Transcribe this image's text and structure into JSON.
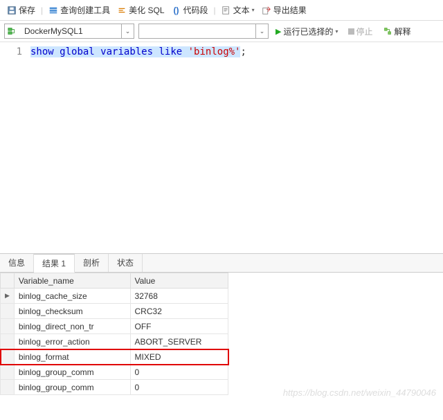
{
  "toolbar": {
    "save": "保存",
    "query_builder": "查询创建工具",
    "beautify": "美化 SQL",
    "snippet": "代码段",
    "text": "文本",
    "export": "导出结果"
  },
  "row2": {
    "connection": "DockerMySQL1",
    "database": "",
    "run": "运行已选择的",
    "stop": "停止",
    "explain": "解释"
  },
  "editor": {
    "line_no": "1",
    "tokens": {
      "t1": "show",
      "t2": "global",
      "t3": "variables",
      "t4": "like",
      "t5": "'binlog%'",
      "t6": ";"
    }
  },
  "tabs": [
    "信息",
    "结果 1",
    "剖析",
    "状态"
  ],
  "active_tab": 1,
  "grid": {
    "columns": [
      "Variable_name",
      "Value"
    ],
    "rows": [
      {
        "name": "binlog_cache_size",
        "value": "32768",
        "indicator": "▶"
      },
      {
        "name": "binlog_checksum",
        "value": "CRC32"
      },
      {
        "name": "binlog_direct_non_tr",
        "value": "OFF"
      },
      {
        "name": "binlog_error_action",
        "value": "ABORT_SERVER"
      },
      {
        "name": "binlog_format",
        "value": "MIXED",
        "highlight": true
      },
      {
        "name": "binlog_group_comm",
        "value": "0"
      },
      {
        "name": "binlog_group_comm",
        "value": "0"
      }
    ]
  },
  "watermark": "https://blog.csdn.net/weixin_44790046"
}
